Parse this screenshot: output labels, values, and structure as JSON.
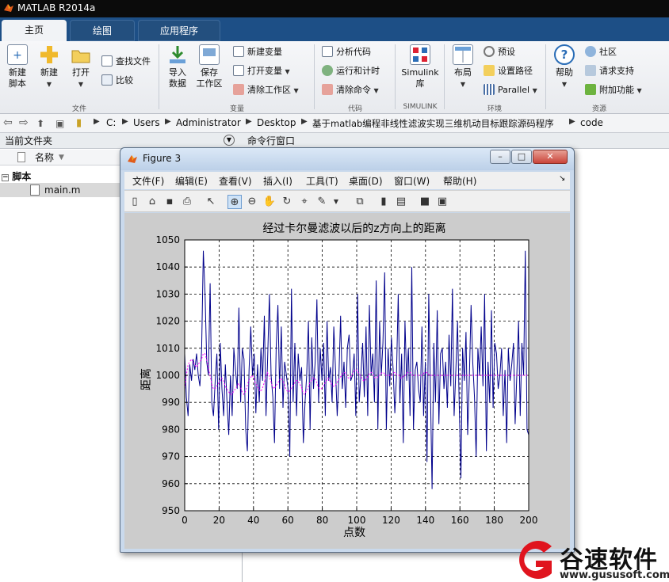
{
  "app": {
    "title": "MATLAB R2014a"
  },
  "tabs": [
    "主页",
    "绘图",
    "应用程序"
  ],
  "ribbon": {
    "file_group": {
      "new_script": [
        "新建",
        "脚本"
      ],
      "new": "新建",
      "open": "打开",
      "find_files": "查找文件",
      "compare": "比较",
      "label": "文件"
    },
    "variable_group": {
      "import": [
        "导入",
        "数据"
      ],
      "save": [
        "保存",
        "工作区"
      ],
      "new_variable": "新建变量",
      "open_variable": "打开变量",
      "clear_workspace": "清除工作区",
      "label": "变量"
    },
    "code_group": {
      "analyze": "分析代码",
      "run_time": "运行和计时",
      "clear_commands": "清除命令",
      "label": "代码"
    },
    "simulink_group": {
      "simulink": [
        "Simulink",
        "库"
      ],
      "label": "SIMULINK"
    },
    "env_group": {
      "layout": "布局",
      "preferences": "预设",
      "set_path": "设置路径",
      "parallel": "Parallel",
      "label": "环境"
    },
    "resources_group": {
      "help": "帮助",
      "community": "社区",
      "support": "请求支持",
      "addons": "附加功能",
      "label": "资源"
    }
  },
  "address": {
    "crumbs": [
      "C:",
      "Users",
      "Administrator",
      "Desktop",
      "基于matlab编程非线性滤波实现三维机动目标跟踪源码程序",
      "code"
    ]
  },
  "left_panel": {
    "title": "当前文件夹",
    "col_name": "名称",
    "folder": "脚本",
    "file": "main.m"
  },
  "command_window": {
    "title": "命令行窗口"
  },
  "figure": {
    "title": "Figure 3",
    "menu": [
      "文件(F)",
      "编辑(E)",
      "查看(V)",
      "插入(I)",
      "工具(T)",
      "桌面(D)",
      "窗口(W)",
      "帮助(H)"
    ]
  },
  "chart_data": {
    "type": "line",
    "title": "经过卡尔曼滤波以后的z方向上的距离",
    "xlabel": "点数",
    "ylabel": "距离",
    "xlim": [
      0,
      200
    ],
    "ylim": [
      950,
      1050
    ],
    "xticks": [
      0,
      20,
      40,
      60,
      80,
      100,
      120,
      140,
      160,
      180,
      200
    ],
    "yticks": [
      950,
      960,
      970,
      980,
      990,
      1000,
      1010,
      1020,
      1030,
      1040,
      1050
    ],
    "grid": true,
    "series": [
      {
        "color": "#00008b",
        "style": "solid",
        "values": [
          1008,
          992,
          985,
          1004,
          998,
          1006,
          1002,
          1008,
          1000,
          996,
          1010,
          1046,
          1030,
          1005,
          1000,
          1034,
          990,
          985,
          998,
          1008,
          980,
          1012,
          995,
          985,
          1004,
          990,
          978,
          1000,
          985,
          1010,
          1002,
          995,
          1025,
          990,
          1010,
          1006,
          980,
          972,
          1002,
          1018,
          1000,
          1008,
          986,
          1004,
          990,
          1010,
          998,
          1022,
          985,
          1008,
          1030,
          1000,
          992,
          975,
          1010,
          1026,
          995,
          1018,
          988,
          1005,
          1000,
          995,
          970,
          1032,
          990,
          1012,
          985,
          1008,
          998,
          1003,
          975,
          990,
          1000,
          1020,
          980,
          1014,
          995,
          1005,
          1028,
          990,
          1010,
          998,
          1012,
          985,
          1020,
          998,
          1003,
          990,
          1018,
          1002,
          985,
          1000,
          1022,
          995,
          1005,
          988,
          1010,
          1015,
          998,
          1000,
          1008,
          985,
          1030,
          990,
          1000,
          1012,
          992,
          1018,
          985,
          1026,
          1000,
          1008,
          990,
          1035,
          980,
          1020,
          1000,
          1012,
          1038,
          980,
          1010,
          996,
          1014,
          1002,
          986,
          1000,
          1030,
          990,
          1008,
          975,
          1020,
          998,
          1010,
          985,
          1040,
          980,
          1002,
          1005,
          995,
          990,
          1018,
          985,
          1005,
          968,
          1030,
          995,
          958,
          1012,
          990,
          1024,
          982,
          1008,
          1010,
          995,
          1005,
          988,
          1015,
          996,
          1032,
          985,
          1002,
          1020,
          990,
          962,
          1010,
          998,
          1016,
          978,
          1000,
          1026,
          1005,
          992,
          970,
          1010,
          1000,
          1018,
          996,
          1030,
          972,
          1005,
          990,
          1024,
          988,
          1012,
          1008,
          995,
          1000,
          1010,
          985,
          1002,
          975,
          1010,
          998,
          1004,
          1012,
          982,
          1000,
          1020,
          985,
          1012,
          1000,
          1046,
          980,
          978
        ]
      },
      {
        "color": "#ff00ff",
        "style": "dotted",
        "values": [
          995,
          1000,
          1004,
          1005,
          1006,
          1005,
          1004,
          1003,
          1004,
          1005,
          1006,
          1008,
          1008,
          1006,
          1003,
          1000,
          997,
          995,
          995,
          996,
          997,
          998,
          999,
          998,
          996,
          995,
          994,
          993,
          993,
          994,
          995,
          996,
          997,
          996,
          994,
          993,
          994,
          996,
          998,
          999,
          1000,
          999,
          997,
          996,
          995,
          994,
          995,
          997,
          999,
          1001,
          1000,
          998,
          996,
          995,
          996,
          997,
          998,
          999,
          998,
          997,
          995,
          994,
          994,
          995,
          996,
          997,
          998,
          998,
          997,
          996,
          994,
          993,
          994,
          995,
          997,
          998,
          999,
          999,
          998,
          996,
          995,
          995,
          996,
          997,
          998,
          999,
          998,
          997,
          996,
          996,
          997,
          998,
          999,
          1000,
          1001,
          1001,
          1000,
          999,
          999,
          1000,
          1001,
          1002,
          1002,
          1001,
          1000,
          999,
          998,
          998,
          999,
          1000,
          1001,
          1001,
          1000,
          999,
          999,
          1000,
          1000,
          1001,
          1001,
          1000,
          1000,
          1000,
          1000,
          1000,
          1001,
          1001,
          1000,
          1000,
          999,
          999,
          1000,
          1000,
          1001,
          1001,
          1001,
          1000,
          1000,
          1000,
          1000,
          1000,
          1000,
          1000,
          1001,
          1001,
          1001,
          1000,
          1000,
          1000,
          1000,
          1000,
          1000,
          1000,
          1000,
          1000,
          1000,
          1000,
          1000,
          1000,
          1000,
          1000,
          1000,
          1000,
          1000,
          1000,
          1000,
          1000,
          1000,
          1000,
          1000,
          1000,
          1000,
          1000,
          1000,
          1000,
          1000,
          1000,
          1000,
          1000,
          1000,
          1000,
          1000,
          1000,
          1000,
          1000,
          1000,
          1000,
          1000,
          1000,
          1000,
          1000,
          1000,
          1000,
          1000,
          1000,
          1000,
          1000,
          1000,
          1000,
          1000,
          1000,
          1000,
          1000,
          1000,
          1000,
          1000
        ]
      }
    ]
  },
  "watermark": {
    "brand": "谷速软件",
    "url": "www.gususoft.com"
  },
  "colors": {
    "title_bg": "#0b0b0b",
    "tabstrip": "#1d4f86",
    "plot_blue": "#00008b",
    "plot_magenta": "#ff00ff",
    "watermark_red": "#e0141e"
  }
}
